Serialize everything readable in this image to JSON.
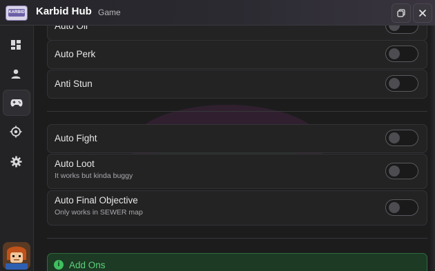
{
  "window": {
    "title": "Karbid Hub",
    "subtitle": "Game",
    "logo_text": "KARBID"
  },
  "sidebar": {
    "items": [
      {
        "name": "dashboard"
      },
      {
        "name": "player"
      },
      {
        "name": "game",
        "active": true
      },
      {
        "name": "target"
      },
      {
        "name": "settings"
      }
    ]
  },
  "main": {
    "partial_row_label": "Auto Oil",
    "rows_group1": [
      {
        "label": "Auto Perk",
        "enabled": false
      },
      {
        "label": "Anti Stun",
        "enabled": false
      }
    ],
    "rows_group2": [
      {
        "label": "Auto Fight",
        "enabled": false
      },
      {
        "label": "Auto Loot",
        "desc": "It works but kinda buggy",
        "enabled": false
      },
      {
        "label": "Auto Final Objective",
        "desc": "Only works in SEWER map",
        "enabled": false
      }
    ],
    "info_banner": {
      "label": "Add Ons"
    }
  },
  "colors": {
    "accent_green": "#5ed17a",
    "toggle_off": "#4c4c51",
    "background": "#1c1c1d"
  }
}
